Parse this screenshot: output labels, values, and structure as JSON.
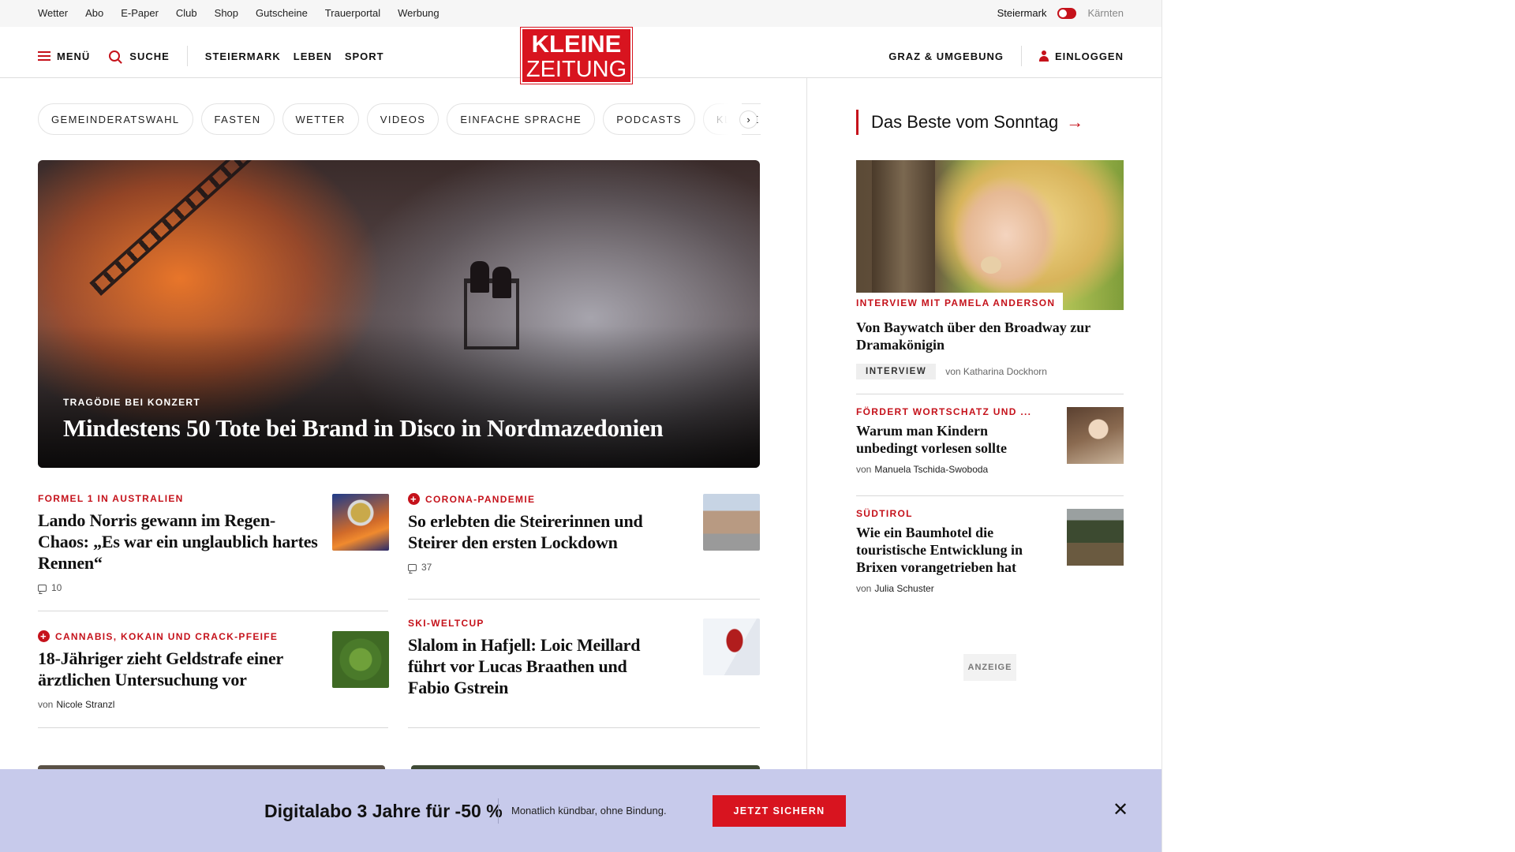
{
  "topbar": {
    "links": [
      "Wetter",
      "Abo",
      "E-Paper",
      "Club",
      "Shop",
      "Gutscheine",
      "Trauerportal",
      "Werbung"
    ],
    "region_active": "Steiermark",
    "region_inactive": "Kärnten"
  },
  "header": {
    "menu_label": "MENÜ",
    "search_label": "SUCHE",
    "nav": [
      "STEIERMARK",
      "LEBEN",
      "SPORT"
    ],
    "logo_line1": "KLEINE",
    "logo_line2": "ZEITUNG",
    "region_link": "GRAZ & UMGEBUNG",
    "login_label": "EINLOGGEN",
    "brand_color": "#d8141f"
  },
  "pills": [
    "GEMEINDERATSWAHL",
    "FASTEN",
    "WETTER",
    "VIDEOS",
    "EINFACHE SPRACHE",
    "PODCASTS",
    "KLEINE KINDE"
  ],
  "hero": {
    "kicker": "TRAGÖDIE BEI KONZERT",
    "title": "Mindestens 50 Tote bei Brand in Disco in Nordmazedonien"
  },
  "articles": [
    {
      "kicker": "FORMEL 1 IN AUSTRALIEN",
      "title": "Lando Norris gewann im Regen-Chaos: „Es war ein unglaublich hartes Rennen“",
      "comments": "10",
      "premium": false
    },
    {
      "kicker": "CORONA-PANDEMIE",
      "title": "So erlebten die Steirerinnen und Steirer den ersten Lockdown",
      "comments": "37",
      "premium": true
    },
    {
      "kicker": "CANNABIS, KOKAIN UND CRACK-PFEIFE",
      "title": "18-Jähriger zieht Geldstrafe einer ärztlichen Untersuchung vor",
      "author_prefix": "von",
      "author": "Nicole Stranzl",
      "premium": true
    },
    {
      "kicker": "SKI-WELTCUP",
      "title": "Slalom in Hafjell: Loic Meillard führt vor Lucas Braathen und Fabio Gstrein",
      "premium": false
    }
  ],
  "sidebar": {
    "heading": "Das Beste vom Sonntag",
    "featured": {
      "kicker": "INTERVIEW MIT PAMELA ANDERSON",
      "title": "Von Baywatch über den Broadway zur Dramakönigin",
      "badge": "INTERVIEW",
      "byline": "von Katharina Dockhorn"
    },
    "items": [
      {
        "kicker": "FÖRDERT WORTSCHATZ UND ...",
        "title": "Warum man Kindern unbedingt vorlesen sollte",
        "author_prefix": "von",
        "author": "Manuela Tschida-Swoboda"
      },
      {
        "kicker": "SÜDTIROL",
        "title": "Wie ein Baumhotel die touristische Entwicklung in Brixen vorangetrieben hat",
        "author_prefix": "von",
        "author": "Julia Schuster"
      }
    ],
    "ad_label": "ANZEIGE"
  },
  "promo": {
    "headline": "Digitalabo 3 Jahre für -50 %",
    "sub": "Monatlich kündbar, ohne Bindung.",
    "cta": "JETZT SICHERN",
    "background": "#c7caeb"
  }
}
